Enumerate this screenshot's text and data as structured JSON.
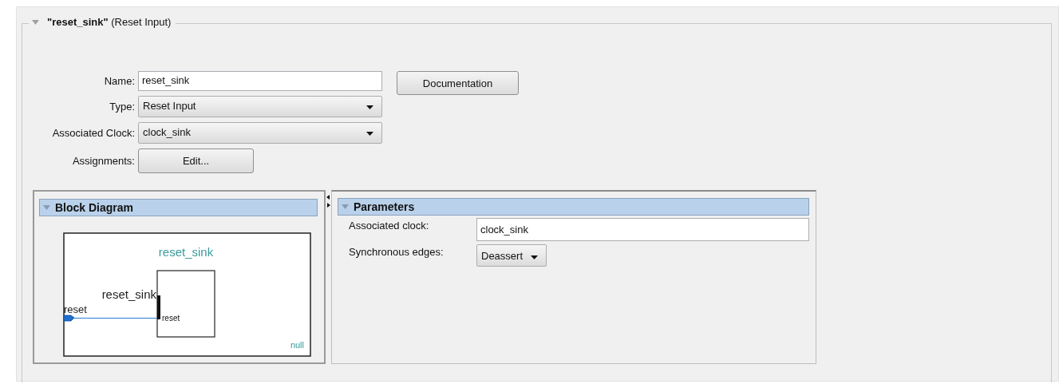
{
  "group": {
    "title": "**\"reset_sink\"** (Reset Input)",
    "expanded": true
  },
  "form": [
    {
      "kind": "text",
      "label": "Name:",
      "value": "reset_sink"
    },
    {
      "kind": "select",
      "label": "Type:",
      "value": "Reset Input"
    },
    {
      "kind": "select",
      "label": "Associated Clock:",
      "value": "clock_sink"
    },
    {
      "kind": "button",
      "label": "Assignments:",
      "value": "Edit..."
    }
  ],
  "documentation_button": "Documentation",
  "block_diagram": {
    "title": "Block Diagram",
    "expanded": true,
    "module_title": "reset_sink",
    "interface_label": "reset_sink",
    "port_label": "reset",
    "pin_label": "reset",
    "footer": "null"
  },
  "parameters": {
    "title": "Parameters",
    "expanded": true,
    "rows": [
      {
        "kind": "text",
        "label": "Associated clock:",
        "value": "clock_sink"
      },
      {
        "kind": "select",
        "label": "Synchronous edges:",
        "value": "Deassert"
      }
    ]
  }
}
